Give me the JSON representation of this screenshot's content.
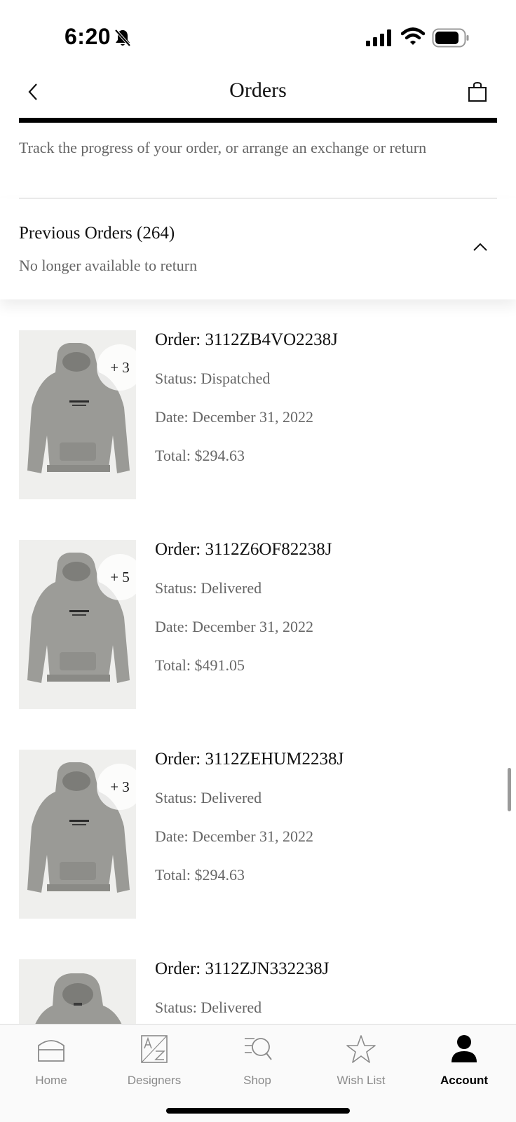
{
  "status_bar": {
    "time": "6:20"
  },
  "header": {
    "title": "Orders"
  },
  "intro": "Track the progress of your order, or arrange an exchange or return",
  "previous_orders": {
    "title": "Previous Orders (264)",
    "subtitle": "No longer available to return"
  },
  "orders": [
    {
      "id": "Order: 3112ZB4VO2238J",
      "status": "Status: Dispatched",
      "date": "Date: December 31, 2022",
      "total": "Total: $294.63",
      "more": "+ 3"
    },
    {
      "id": "Order: 3112Z6OF82238J",
      "status": "Status: Delivered",
      "date": "Date: December 31, 2022",
      "total": "Total: $491.05",
      "more": "+ 5"
    },
    {
      "id": "Order: 3112ZEHUM2238J",
      "status": "Status: Delivered",
      "date": "Date: December 31, 2022",
      "total": "Total: $294.63",
      "more": "+ 3"
    },
    {
      "id": "Order: 3112ZJN332238J",
      "status": "Status: Delivered"
    }
  ],
  "tab_bar": {
    "tabs": [
      {
        "label": "Home",
        "icon": "home-icon"
      },
      {
        "label": "Designers",
        "icon": "designers-az-icon"
      },
      {
        "label": "Shop",
        "icon": "shop-search-icon"
      },
      {
        "label": "Wish List",
        "icon": "star-icon"
      },
      {
        "label": "Account",
        "icon": "account-icon",
        "active": true
      }
    ]
  },
  "colors": {
    "text_primary": "#111111",
    "text_secondary": "#666666",
    "rule": "#000000",
    "tab_inactive": "#8a8a8a"
  }
}
